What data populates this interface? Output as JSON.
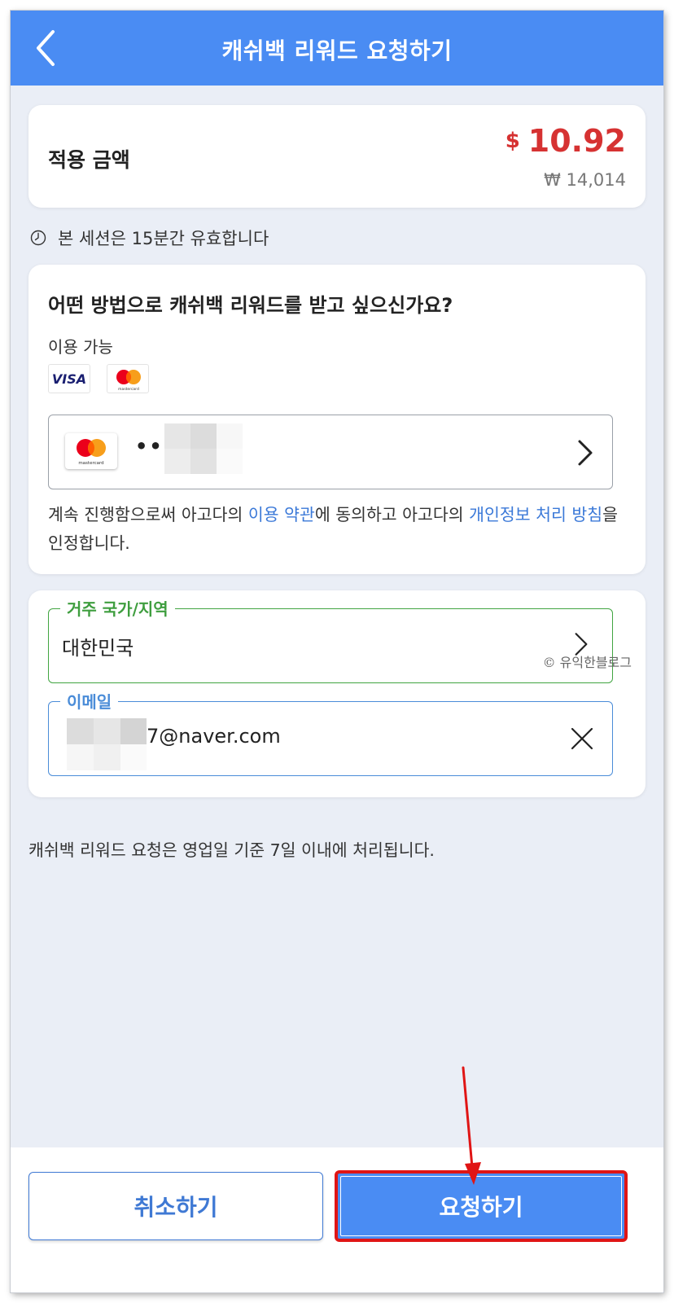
{
  "header": {
    "title": "캐쉬백 리워드 요청하기",
    "back_icon": "chevron-left-icon"
  },
  "amount": {
    "label": "적용 금액",
    "usd_symbol": "$",
    "usd_value": "10.92",
    "krw": "₩ 14,014",
    "accent_color": "#d63232"
  },
  "session": {
    "icon": "clock-icon",
    "text": "본 세션은 15분간 유효합니다"
  },
  "payment_method": {
    "question": "어떤 방법으로 캐쉬백 리워드를 받고 싶으신가요?",
    "available_label": "이용 가능",
    "brands": [
      "visa-logo",
      "mastercard-logo"
    ],
    "visa_text": "VISA",
    "mastercard_text": "mastercard",
    "selected_card": {
      "dots": "••••",
      "brand": "mastercard-logo",
      "chevron": "chevron-right-icon"
    },
    "terms": {
      "t1": "계속 진행함으로써 아고다의 ",
      "link1": "이용 약관",
      "t2": "에 동의하고 아고다의 ",
      "link2": "개인정보 처리 방침",
      "t3": "을 인정합니다.",
      "link_color": "#3b79d8"
    }
  },
  "form": {
    "country": {
      "label": "거주 국가/지역",
      "value": "대한민국",
      "border_color": "#41a541",
      "chevron": "chevron-right-icon"
    },
    "email": {
      "label": "이메일",
      "value": "7@naver.com",
      "border_color": "#4a8cd8",
      "clear_icon": "close-icon"
    },
    "watermark": "© 유익한블로그"
  },
  "notice": "캐쉬백 리워드 요청은 영업일 기준 7일 이내에 처리됩니다.",
  "buttons": {
    "cancel": "취소하기",
    "request": "요청하기",
    "primary_color": "#4a8cf3",
    "highlight_color": "#e01515"
  }
}
